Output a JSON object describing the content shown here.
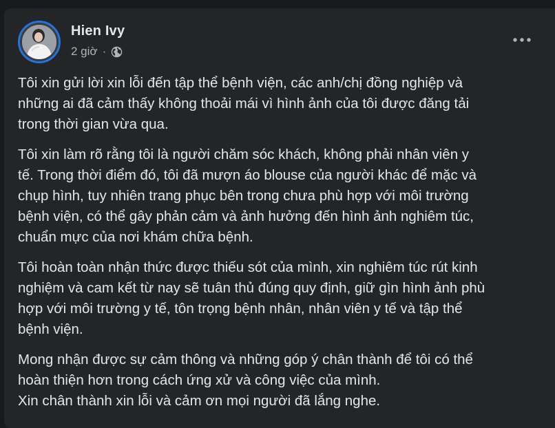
{
  "post": {
    "author": "Hien Ivy",
    "time": "2 giờ",
    "separator": "·",
    "privacy_icon": "globe-icon",
    "more_icon": "more-horizontal-icon",
    "paragraphs": [
      "Tôi xin gửi lời xin lỗi đến tập thể bệnh viện, các anh/chị đồng nghiệp và\nnhững ai đã cảm thấy không thoải mái vì hình ảnh của tôi được đăng tải\ntrong thời gian vừa qua.",
      "Tôi xin làm rõ rằng tôi là người chăm sóc khách, không phải nhân viên y\ntế. Trong thời điểm đó, tôi đã mượn áo blouse của người khác để mặc và\nchụp hình, tuy nhiên trang phục bên trong chưa phù hợp với môi trường\nbệnh viện, có thể gây phản cảm và ảnh hưởng đến hình ảnh nghiêm túc,\nchuẩn mực của nơi khám chữa bệnh.",
      "Tôi hoàn toàn nhận thức được thiếu sót của mình, xin nghiêm túc rút kinh\nnghiệm và cam kết từ nay sẽ tuân thủ đúng quy định, giữ gìn hình ảnh phù\nhợp với môi trường y tế, tôn trọng bệnh nhân, nhân viên y tế và tập thể\nbệnh viện.",
      "Mong nhận được sự cảm thông và những góp ý chân thành để tôi có thể\nhoàn thiện hơn trong cách ứng xử và công việc của mình.\nXin chân thành xin lỗi và cảm ơn mọi người đã lắng nghe."
    ]
  },
  "colors": {
    "background": "#18191a",
    "card": "#242526",
    "text_primary": "#e4e6eb",
    "text_secondary": "#b0b3b8",
    "avatar_ring": "#2374e1"
  }
}
